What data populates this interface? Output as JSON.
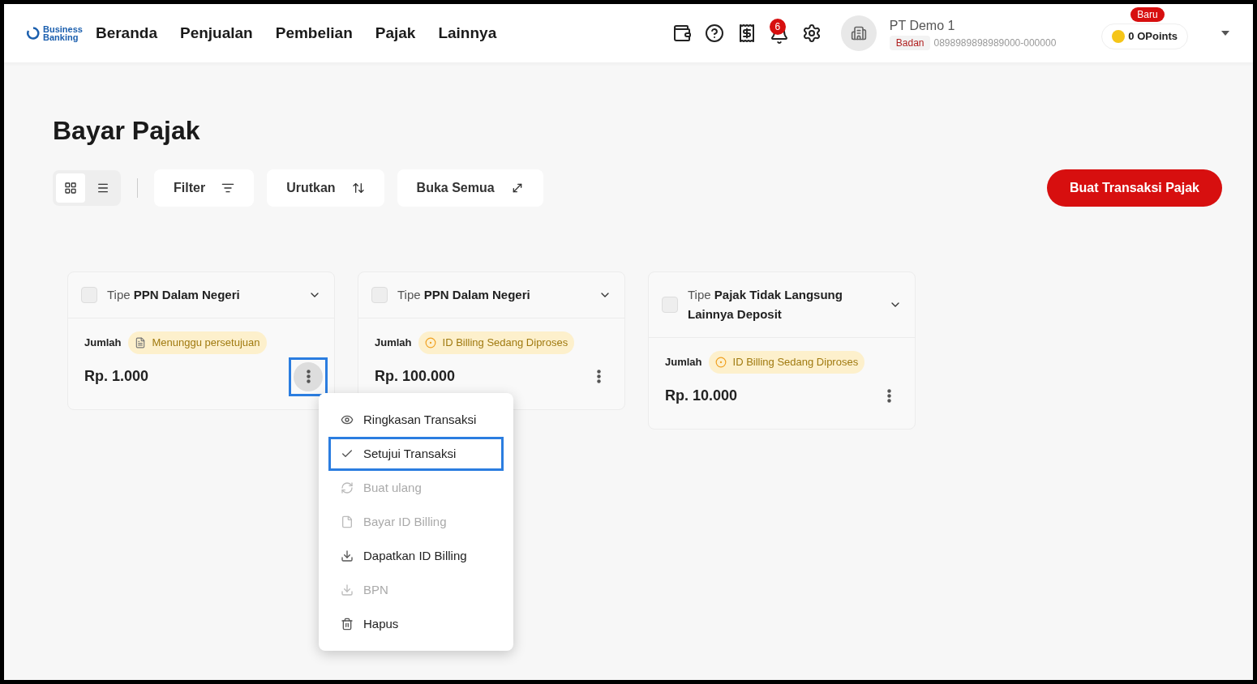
{
  "nav": {
    "logo": [
      "Business",
      "Banking"
    ],
    "items": [
      "Beranda",
      "Penjualan",
      "Pembelian",
      "Pajak",
      "Lainnya"
    ]
  },
  "header": {
    "notification_count": "6",
    "company": "PT Demo 1",
    "entity_tag": "Badan",
    "entity_id": "0898989898989000-000000",
    "points_badge": "Baru",
    "points": "0 OPoints"
  },
  "page": {
    "title": "Bayar Pajak"
  },
  "toolbar": {
    "views": [
      {
        "kind": "grid",
        "selected": true
      },
      {
        "kind": "list",
        "selected": false
      }
    ],
    "buttons": [
      {
        "kind": "filter",
        "label": "Filter"
      },
      {
        "kind": "sort",
        "label": "Urutkan"
      },
      {
        "kind": "expand",
        "label": "Buka Semua"
      }
    ],
    "primary": "Buat Transaksi Pajak"
  },
  "cards": [
    {
      "type_prefix": "Tipe",
      "type_name": "PPN Dalam Negeri",
      "checked": false,
      "amount_label": "Jumlah",
      "status": {
        "kind": "pending",
        "label": "Menunggu persetujuan"
      },
      "amount": "Rp. 1.000",
      "menu_open": true,
      "highlighted": true
    },
    {
      "type_prefix": "Tipe",
      "type_name": "PPN Dalam Negeri",
      "checked": false,
      "amount_label": "Jumlah",
      "status": {
        "kind": "processing",
        "label": "ID Billing Sedang Diproses"
      },
      "amount": "Rp. 100.000",
      "menu_open": false,
      "highlighted": false
    },
    {
      "type_prefix": "Tipe",
      "type_name": "Pajak Tidak Langsung Lainnya Deposit",
      "checked": false,
      "amount_label": "Jumlah",
      "status": {
        "kind": "processing",
        "label": "ID Billing Sedang Diproses"
      },
      "amount": "Rp. 10.000",
      "menu_open": false,
      "highlighted": false
    }
  ],
  "menu": [
    {
      "kind": "eye",
      "label": "Ringkasan Transaksi",
      "disabled": false,
      "highlighted": false
    },
    {
      "kind": "check",
      "label": "Setujui Transaksi",
      "disabled": false,
      "highlighted": true
    },
    {
      "kind": "refresh",
      "label": "Buat ulang",
      "disabled": true,
      "highlighted": false
    },
    {
      "kind": "file",
      "label": "Bayar ID Billing",
      "disabled": true,
      "highlighted": false
    },
    {
      "kind": "download",
      "label": "Dapatkan ID Billing",
      "disabled": false,
      "highlighted": false
    },
    {
      "kind": "download",
      "label": "BPN",
      "disabled": true,
      "highlighted": false
    },
    {
      "kind": "trash",
      "label": "Hapus",
      "disabled": false,
      "highlighted": false
    }
  ]
}
